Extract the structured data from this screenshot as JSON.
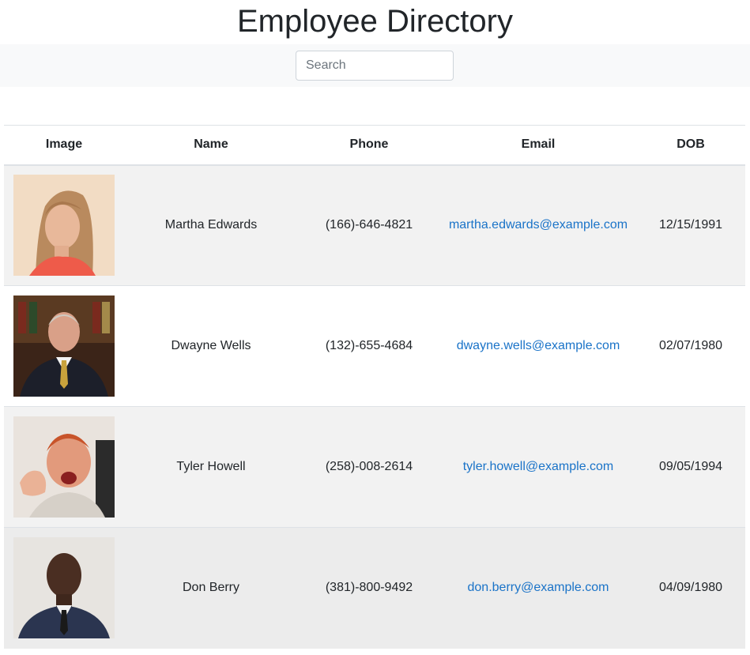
{
  "page": {
    "title": "Employee Directory"
  },
  "search": {
    "placeholder": "Search",
    "value": ""
  },
  "table": {
    "headers": [
      "Image",
      "Name",
      "Phone",
      "Email",
      "DOB"
    ],
    "rows": [
      {
        "name": "Martha Edwards",
        "phone": "(166)-646-4821",
        "email": "martha.edwards@example.com",
        "dob": "12/15/1991"
      },
      {
        "name": "Dwayne Wells",
        "phone": "(132)-655-4684",
        "email": "dwayne.wells@example.com",
        "dob": "02/07/1980"
      },
      {
        "name": "Tyler Howell",
        "phone": "(258)-008-2614",
        "email": "tyler.howell@example.com",
        "dob": "09/05/1994"
      },
      {
        "name": "Don Berry",
        "phone": "(381)-800-9492",
        "email": "don.berry@example.com",
        "dob": "04/09/1980"
      }
    ]
  },
  "colors": {
    "link": "#1a73c8",
    "search_bar_bg": "#f8f9fa",
    "row_stripe": "#f2f2f2"
  }
}
